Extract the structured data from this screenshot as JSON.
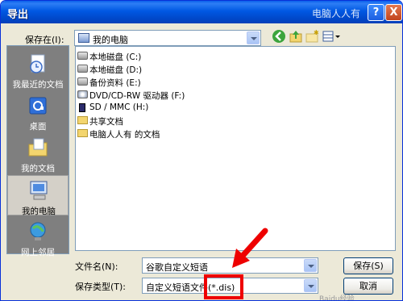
{
  "window": {
    "title": "导出",
    "watermark_title": "电脑人人有",
    "help_button": "?",
    "close_button": "X"
  },
  "save_in": {
    "label": "保存在(I):",
    "value": "我的电脑"
  },
  "places": [
    {
      "label": "我最近的文档",
      "icon": "recent-documents-icon"
    },
    {
      "label": "桌面",
      "icon": "desktop-icon"
    },
    {
      "label": "我的文档",
      "icon": "my-documents-icon"
    },
    {
      "label": "我的电脑",
      "icon": "my-computer-icon",
      "selected": true
    },
    {
      "label": "网上邻居",
      "icon": "network-icon"
    }
  ],
  "file_list": [
    {
      "name": "本地磁盘 (C:)",
      "icon": "drive-icon"
    },
    {
      "name": "本地磁盘 (D:)",
      "icon": "drive-icon"
    },
    {
      "name": "备份资料 (E:)",
      "icon": "drive-icon"
    },
    {
      "name": "DVD/CD-RW 驱动器 (F:)",
      "icon": "cd-drive-icon"
    },
    {
      "name": "SD / MMC (H:)",
      "icon": "sd-card-icon"
    },
    {
      "name": "共享文档",
      "icon": "folder-icon"
    },
    {
      "name": "电脑人人有 的文档",
      "icon": "folder-icon"
    }
  ],
  "filename": {
    "label": "文件名(N):",
    "value": "谷歌自定义短语"
  },
  "filetype": {
    "label": "保存类型(T):",
    "value": "自定义短语文件(*.dis)"
  },
  "buttons": {
    "save": "保存(S)",
    "cancel": "取消"
  },
  "watermark_bottom": "Baidu经验",
  "colors": {
    "titlebar": "#0058E3",
    "dialog_bg": "#ECE9D8",
    "highlight": "#E00000"
  }
}
